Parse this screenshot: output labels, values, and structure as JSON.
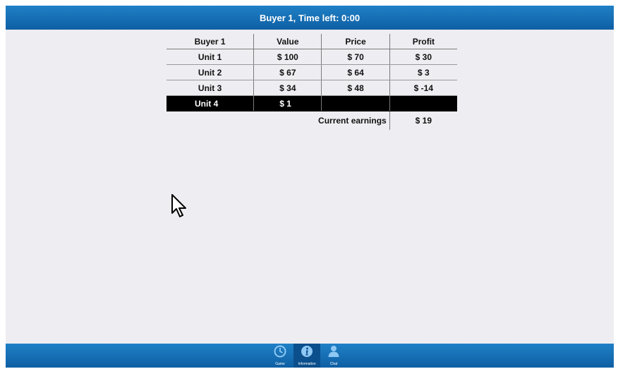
{
  "header": {
    "title": "Buyer 1, Time left: 0:00"
  },
  "table": {
    "columns": [
      "Buyer 1",
      "Value",
      "Price",
      "Profit"
    ],
    "rows": [
      {
        "unit": "Unit 1",
        "value": "$ 100",
        "price": "$ 70",
        "profit": "$ 30"
      },
      {
        "unit": "Unit 2",
        "value": "$ 67",
        "price": "$ 64",
        "profit": "$ 3"
      },
      {
        "unit": "Unit 3",
        "value": "$ 34",
        "price": "$ 48",
        "profit": "$ -14"
      },
      {
        "unit": "Unit 4",
        "value": "$ 1",
        "price": "",
        "profit": ""
      }
    ],
    "earnings_label": "Current earnings",
    "earnings_value": "$ 19"
  },
  "nav": {
    "items": [
      {
        "label": "Game",
        "icon": "clock-icon"
      },
      {
        "label": "Information",
        "icon": "info-icon"
      },
      {
        "label": "Chat",
        "icon": "person-icon"
      }
    ]
  },
  "colors": {
    "bar": "#1670b8",
    "background": "#eeeef2",
    "active_row": "#000000"
  }
}
